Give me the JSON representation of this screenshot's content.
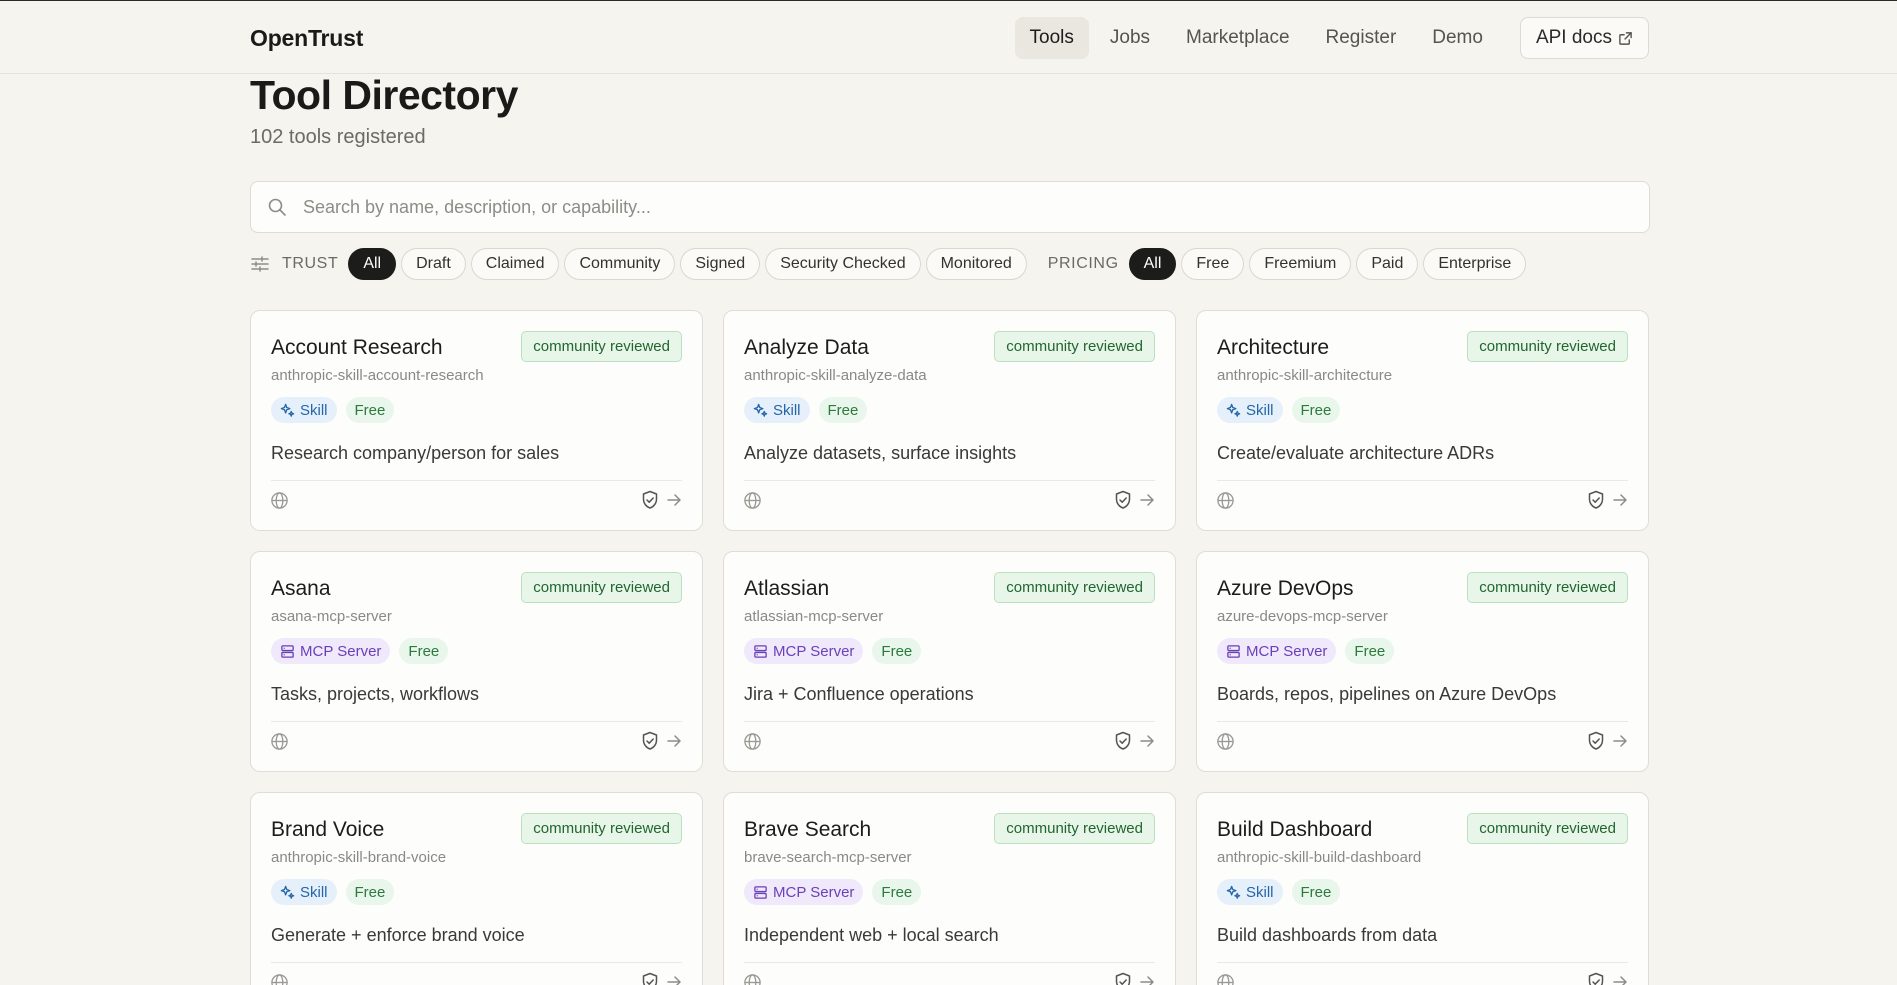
{
  "header": {
    "brand": "OpenTrust",
    "nav": [
      {
        "label": "Tools",
        "active": true
      },
      {
        "label": "Jobs",
        "active": false
      },
      {
        "label": "Marketplace",
        "active": false
      },
      {
        "label": "Register",
        "active": false
      },
      {
        "label": "Demo",
        "active": false
      }
    ],
    "api_docs_label": "API docs",
    "api_docs_icon": "external-link-icon"
  },
  "page": {
    "title": "Tool Directory",
    "subtitle": "102 tools registered"
  },
  "search": {
    "value": "",
    "placeholder": "Search by name, description, or capability..."
  },
  "filters": {
    "trust_label": "TRUST",
    "trust": [
      "All",
      "Draft",
      "Claimed",
      "Community",
      "Signed",
      "Security Checked",
      "Monitored"
    ],
    "trust_selected": "All",
    "pricing_label": "PRICING",
    "pricing": [
      "All",
      "Free",
      "Freemium",
      "Paid",
      "Enterprise"
    ],
    "pricing_selected": "All"
  },
  "cards": [
    {
      "name": "Account Research",
      "slug": "anthropic-skill-account-research",
      "badge": "community reviewed",
      "type": "Skill",
      "pricing": "Free",
      "description": "Research company/person for sales"
    },
    {
      "name": "Analyze Data",
      "slug": "anthropic-skill-analyze-data",
      "badge": "community reviewed",
      "type": "Skill",
      "pricing": "Free",
      "description": "Analyze datasets, surface insights"
    },
    {
      "name": "Architecture",
      "slug": "anthropic-skill-architecture",
      "badge": "community reviewed",
      "type": "Skill",
      "pricing": "Free",
      "description": "Create/evaluate architecture ADRs"
    },
    {
      "name": "Asana",
      "slug": "asana-mcp-server",
      "badge": "community reviewed",
      "type": "MCP Server",
      "pricing": "Free",
      "description": "Tasks, projects, workflows"
    },
    {
      "name": "Atlassian",
      "slug": "atlassian-mcp-server",
      "badge": "community reviewed",
      "type": "MCP Server",
      "pricing": "Free",
      "description": "Jira + Confluence operations"
    },
    {
      "name": "Azure DevOps",
      "slug": "azure-devops-mcp-server",
      "badge": "community reviewed",
      "type": "MCP Server",
      "pricing": "Free",
      "description": "Boards, repos, pipelines on Azure DevOps"
    },
    {
      "name": "Brand Voice",
      "slug": "anthropic-skill-brand-voice",
      "badge": "community reviewed",
      "type": "Skill",
      "pricing": "Free",
      "description": "Generate + enforce brand voice"
    },
    {
      "name": "Brave Search",
      "slug": "brave-search-mcp-server",
      "badge": "community reviewed",
      "type": "MCP Server",
      "pricing": "Free",
      "description": "Independent web + local search"
    },
    {
      "name": "Build Dashboard",
      "slug": "anthropic-skill-build-dashboard",
      "badge": "community reviewed",
      "type": "Skill",
      "pricing": "Free",
      "description": "Build dashboards from data"
    }
  ],
  "colors": {
    "background": "#f5f4ef",
    "accent_dark": "#1c1c1a",
    "badge_green": "#22652f",
    "skill_blue": "#2466a8",
    "mcp_purple": "#6b3fb8"
  }
}
